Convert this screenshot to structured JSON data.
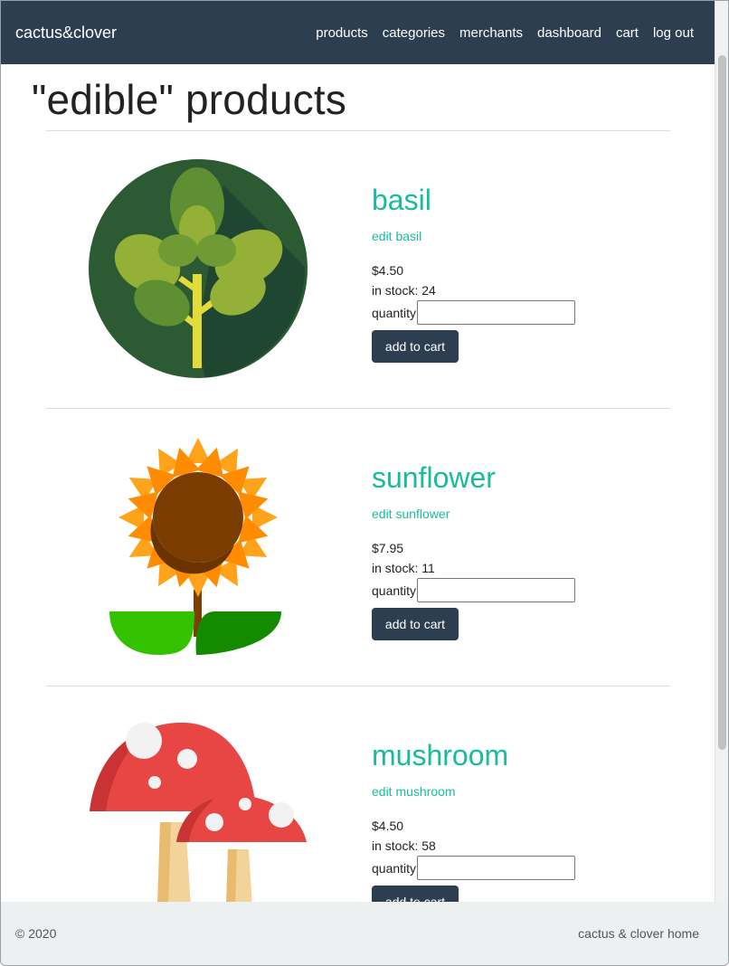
{
  "nav": {
    "brand": "cactus&clover",
    "links": [
      "products",
      "categories",
      "merchants",
      "dashboard",
      "cart",
      "log out"
    ]
  },
  "page": {
    "title": "\"edible\" products"
  },
  "products": [
    {
      "name": "basil",
      "edit_label": "edit basil",
      "price": "$4.50",
      "stock": "in stock: 24",
      "quantity_label": "quantity",
      "quantity_value": "",
      "add_label": "add to cart",
      "image_icon": "basil-icon"
    },
    {
      "name": "sunflower",
      "edit_label": "edit sunflower",
      "price": "$7.95",
      "stock": "in stock: 11",
      "quantity_label": "quantity",
      "quantity_value": "",
      "add_label": "add to cart",
      "image_icon": "sunflower-icon"
    },
    {
      "name": "mushroom",
      "edit_label": "edit mushroom",
      "price": "$4.50",
      "stock": "in stock: 58",
      "quantity_label": "quantity",
      "quantity_value": "",
      "add_label": "add to cart",
      "image_icon": "mushroom-icon"
    }
  ],
  "footer": {
    "copyright": "© 2020",
    "home_link": "cactus & clover home"
  },
  "colors": {
    "navbar": "#2c3e50",
    "accent": "#18bc9c",
    "button": "#2c3e50",
    "footer": "#ecf0f1"
  }
}
